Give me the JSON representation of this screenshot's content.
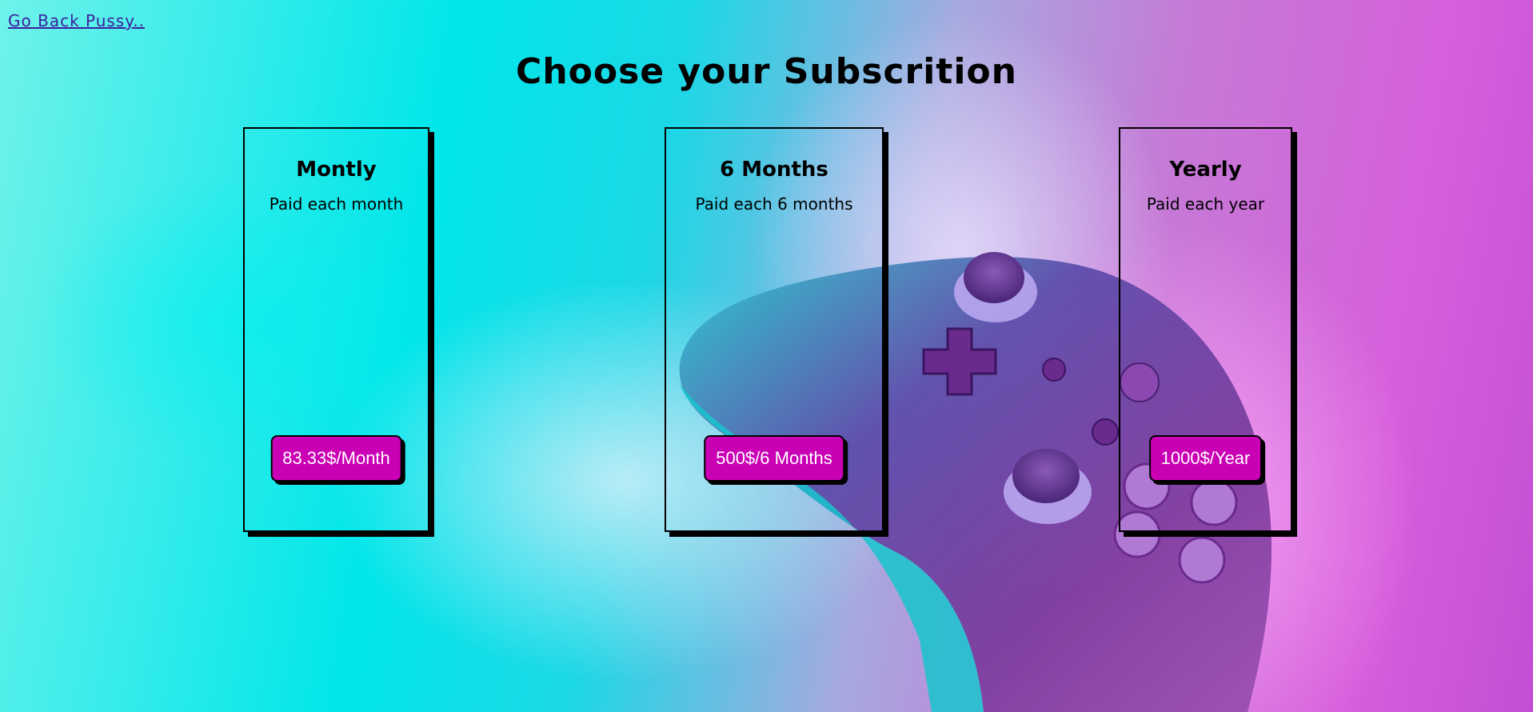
{
  "nav": {
    "back_label": "Go Back Pussy.."
  },
  "header": {
    "title": "Choose your Subscrition"
  },
  "plans": [
    {
      "name": "Montly",
      "description": "Paid each month",
      "price_label": "83.33$/Month"
    },
    {
      "name": "6 Months",
      "description": "Paid each 6 months",
      "price_label": "500$/6 Months"
    },
    {
      "name": "Yearly",
      "description": "Paid each year",
      "price_label": "1000$/Year"
    }
  ],
  "colors": {
    "button_background": "#c900b4",
    "button_text": "#ffffff",
    "border": "#000000",
    "link": "#3a1f9e",
    "background_left": "#00e6ea",
    "background_right": "#c24fd3"
  },
  "background_image": "purple-game-controller"
}
